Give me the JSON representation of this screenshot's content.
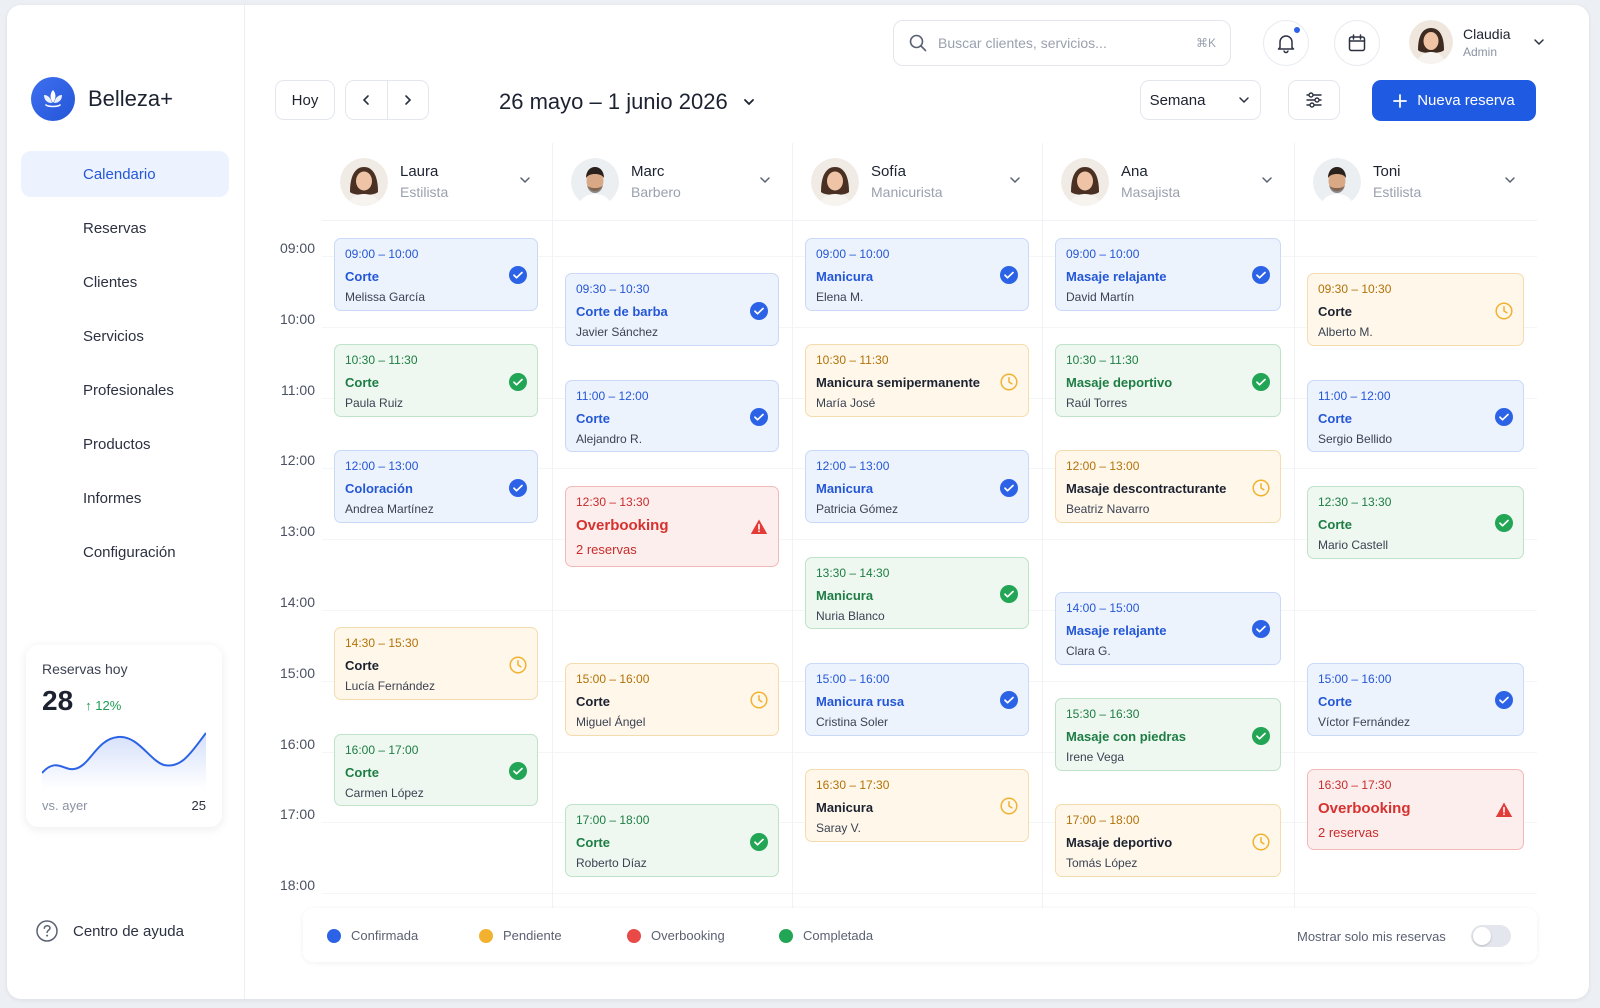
{
  "app": {
    "name": "Belleza+"
  },
  "sidebar": {
    "items": [
      {
        "label": "Calendario",
        "icon": "calendar-icon",
        "active": true
      },
      {
        "label": "Reservas",
        "icon": "list-icon"
      },
      {
        "label": "Clientes",
        "icon": "user-icon"
      },
      {
        "label": "Servicios",
        "icon": "bag-icon"
      },
      {
        "label": "Profesionales",
        "icon": "team-icon"
      },
      {
        "label": "Productos",
        "icon": "bottle-icon"
      },
      {
        "label": "Informes",
        "icon": "bar-chart-icon"
      },
      {
        "label": "Configuración",
        "icon": "gear-icon"
      }
    ],
    "stats": {
      "label": "Reservas hoy",
      "value": "28",
      "change": "12%",
      "compare_label": "vs. ayer",
      "compare_value": "25"
    },
    "help": "Centro de ayuda"
  },
  "topbar": {
    "search_placeholder": "Buscar clientes, servicios...",
    "search_shortcut": "⌘K",
    "user": {
      "name": "Claudia",
      "role": "Admin"
    }
  },
  "toolbar": {
    "today": "Hoy",
    "date_range": "26 mayo – 1 junio 2026",
    "view": "Semana",
    "new_booking": "Nueva reserva"
  },
  "times": [
    "09:00",
    "10:00",
    "11:00",
    "12:00",
    "13:00",
    "14:00",
    "15:00",
    "16:00",
    "17:00",
    "18:00"
  ],
  "staff": [
    {
      "name": "Laura",
      "role": "Estilista",
      "avatar": "female"
    },
    {
      "name": "Marc",
      "role": "Barbero",
      "avatar": "male"
    },
    {
      "name": "Sofía",
      "role": "Manicurista",
      "avatar": "female"
    },
    {
      "name": "Ana",
      "role": "Masajista",
      "avatar": "female"
    },
    {
      "name": "Toni",
      "role": "Estilista",
      "avatar": "male"
    }
  ],
  "appointments": [
    [
      {
        "time": "09:00 – 10:00",
        "service": "Corte",
        "client": "Melissa García",
        "status": "confirmed"
      },
      {
        "time": "10:30 – 11:30",
        "service": "Corte",
        "client": "Paula Ruiz",
        "status": "completed"
      },
      {
        "time": "12:00 – 13:00",
        "service": "Coloración",
        "client": "Andrea Martínez",
        "status": "confirmed"
      },
      {
        "time": "14:30 – 15:30",
        "service": "Corte",
        "client": "Lucía Fernández",
        "status": "pending"
      },
      {
        "time": "16:00 – 17:00",
        "service": "Corte",
        "client": "Carmen López",
        "status": "completed"
      }
    ],
    [
      {
        "time": "09:30 – 10:30",
        "service": "Corte de barba",
        "client": "Javier Sánchez",
        "status": "confirmed"
      },
      {
        "time": "11:00 – 12:00",
        "service": "Corte",
        "client": "Alejandro R.",
        "status": "confirmed"
      },
      {
        "time": "12:30 – 13:30",
        "service": "Overbooking",
        "client": "2 reservas",
        "status": "overbooking"
      },
      {
        "time": "15:00 – 16:00",
        "service": "Corte",
        "client": "Miguel Ángel",
        "status": "pending"
      },
      {
        "time": "17:00 – 18:00",
        "service": "Corte",
        "client": "Roberto Díaz",
        "status": "completed"
      }
    ],
    [
      {
        "time": "09:00 – 10:00",
        "service": "Manicura",
        "client": "Elena M.",
        "status": "confirmed"
      },
      {
        "time": "10:30 – 11:30",
        "service": "Manicura semipermanente",
        "client": "María José",
        "status": "pending"
      },
      {
        "time": "12:00 – 13:00",
        "service": "Manicura",
        "client": "Patricia Gómez",
        "status": "confirmed"
      },
      {
        "time": "13:30 – 14:30",
        "service": "Manicura",
        "client": "Nuria Blanco",
        "status": "completed"
      },
      {
        "time": "15:00 – 16:00",
        "service": "Manicura rusa",
        "client": "Cristina Soler",
        "status": "confirmed"
      },
      {
        "time": "16:30 – 17:30",
        "service": "Manicura",
        "client": "Saray V.",
        "status": "pending"
      }
    ],
    [
      {
        "time": "09:00 – 10:00",
        "service": "Masaje relajante",
        "client": "David Martín",
        "status": "confirmed"
      },
      {
        "time": "10:30 – 11:30",
        "service": "Masaje deportivo",
        "client": "Raúl Torres",
        "status": "completed"
      },
      {
        "time": "12:00 – 13:00",
        "service": "Masaje descontracturante",
        "client": "Beatriz Navarro",
        "status": "pending"
      },
      {
        "time": "14:00 – 15:00",
        "service": "Masaje relajante",
        "client": "Clara G.",
        "status": "confirmed"
      },
      {
        "time": "15:30 – 16:30",
        "service": "Masaje con piedras",
        "client": "Irene Vega",
        "status": "completed"
      },
      {
        "time": "17:00 – 18:00",
        "service": "Masaje deportivo",
        "client": "Tomás López",
        "status": "pending"
      }
    ],
    [
      {
        "time": "09:30 – 10:30",
        "service": "Corte",
        "client": "Alberto M.",
        "status": "pending"
      },
      {
        "time": "11:00 – 12:00",
        "service": "Corte",
        "client": "Sergio Bellido",
        "status": "confirmed"
      },
      {
        "time": "12:30 – 13:30",
        "service": "Corte",
        "client": "Mario Castell",
        "status": "completed"
      },
      {
        "time": "15:00 – 16:00",
        "service": "Corte",
        "client": "Víctor Fernández",
        "status": "confirmed"
      },
      {
        "time": "16:30 – 17:30",
        "service": "Overbooking",
        "client": "2 reservas",
        "status": "overbooking"
      }
    ]
  ],
  "legend": {
    "items": [
      {
        "label": "Confirmada",
        "color": "#2c63e6"
      },
      {
        "label": "Pendiente",
        "color": "#f2b230"
      },
      {
        "label": "Overbooking",
        "color": "#ea4a47"
      },
      {
        "label": "Completada",
        "color": "#22a554"
      }
    ],
    "toggle_label": "Mostrar solo mis reservas",
    "toggle_on": false
  },
  "colors": {
    "accent": "#1f5ae3",
    "confirmed": "#2c63e6",
    "pending": "#f2b230",
    "overbooking": "#ea4a47",
    "completed": "#22a554"
  }
}
